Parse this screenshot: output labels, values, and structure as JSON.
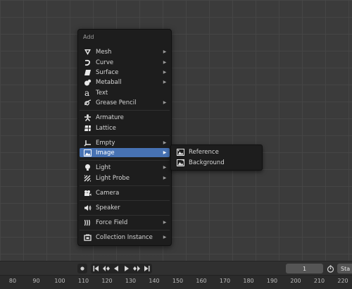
{
  "menu": {
    "title": "Add",
    "items": [
      {
        "label": "Mesh",
        "icon": "mesh-icon",
        "submenu": true
      },
      {
        "label": "Curve",
        "icon": "curve-icon",
        "submenu": true
      },
      {
        "label": "Surface",
        "icon": "surface-icon",
        "submenu": true
      },
      {
        "label": "Metaball",
        "icon": "metaball-icon",
        "submenu": true
      },
      {
        "label": "Text",
        "icon": "text-icon",
        "submenu": false
      },
      {
        "label": "Grease Pencil",
        "icon": "grease-pencil-icon",
        "submenu": true
      },
      {
        "label": "Armature",
        "icon": "armature-icon",
        "submenu": false
      },
      {
        "label": "Lattice",
        "icon": "lattice-icon",
        "submenu": false
      },
      {
        "label": "Empty",
        "icon": "empty-icon",
        "submenu": true
      },
      {
        "label": "Image",
        "icon": "image-icon",
        "submenu": true,
        "active": true
      },
      {
        "label": "Light",
        "icon": "light-icon",
        "submenu": true
      },
      {
        "label": "Light Probe",
        "icon": "light-probe-icon",
        "submenu": true
      },
      {
        "label": "Camera",
        "icon": "camera-icon",
        "submenu": false
      },
      {
        "label": "Speaker",
        "icon": "speaker-icon",
        "submenu": false
      },
      {
        "label": "Force Field",
        "icon": "force-field-icon",
        "submenu": true
      },
      {
        "label": "Collection Instance",
        "icon": "collection-instance-icon",
        "submenu": true
      }
    ]
  },
  "image_submenu": {
    "items": [
      {
        "label": "Reference",
        "icon": "image-reference-icon"
      },
      {
        "label": "Background",
        "icon": "image-background-icon"
      }
    ]
  },
  "timeline": {
    "current_frame": "1",
    "start_label": "Sta",
    "ruler_ticks": [
      "80",
      "90",
      "100",
      "110",
      "120",
      "130",
      "140",
      "150",
      "160",
      "170",
      "180",
      "190",
      "200",
      "210",
      "220"
    ]
  },
  "colors": {
    "accent": "#4772b3",
    "menu_bg": "#1d1d1d",
    "viewport_bg": "#3b3b3b"
  }
}
